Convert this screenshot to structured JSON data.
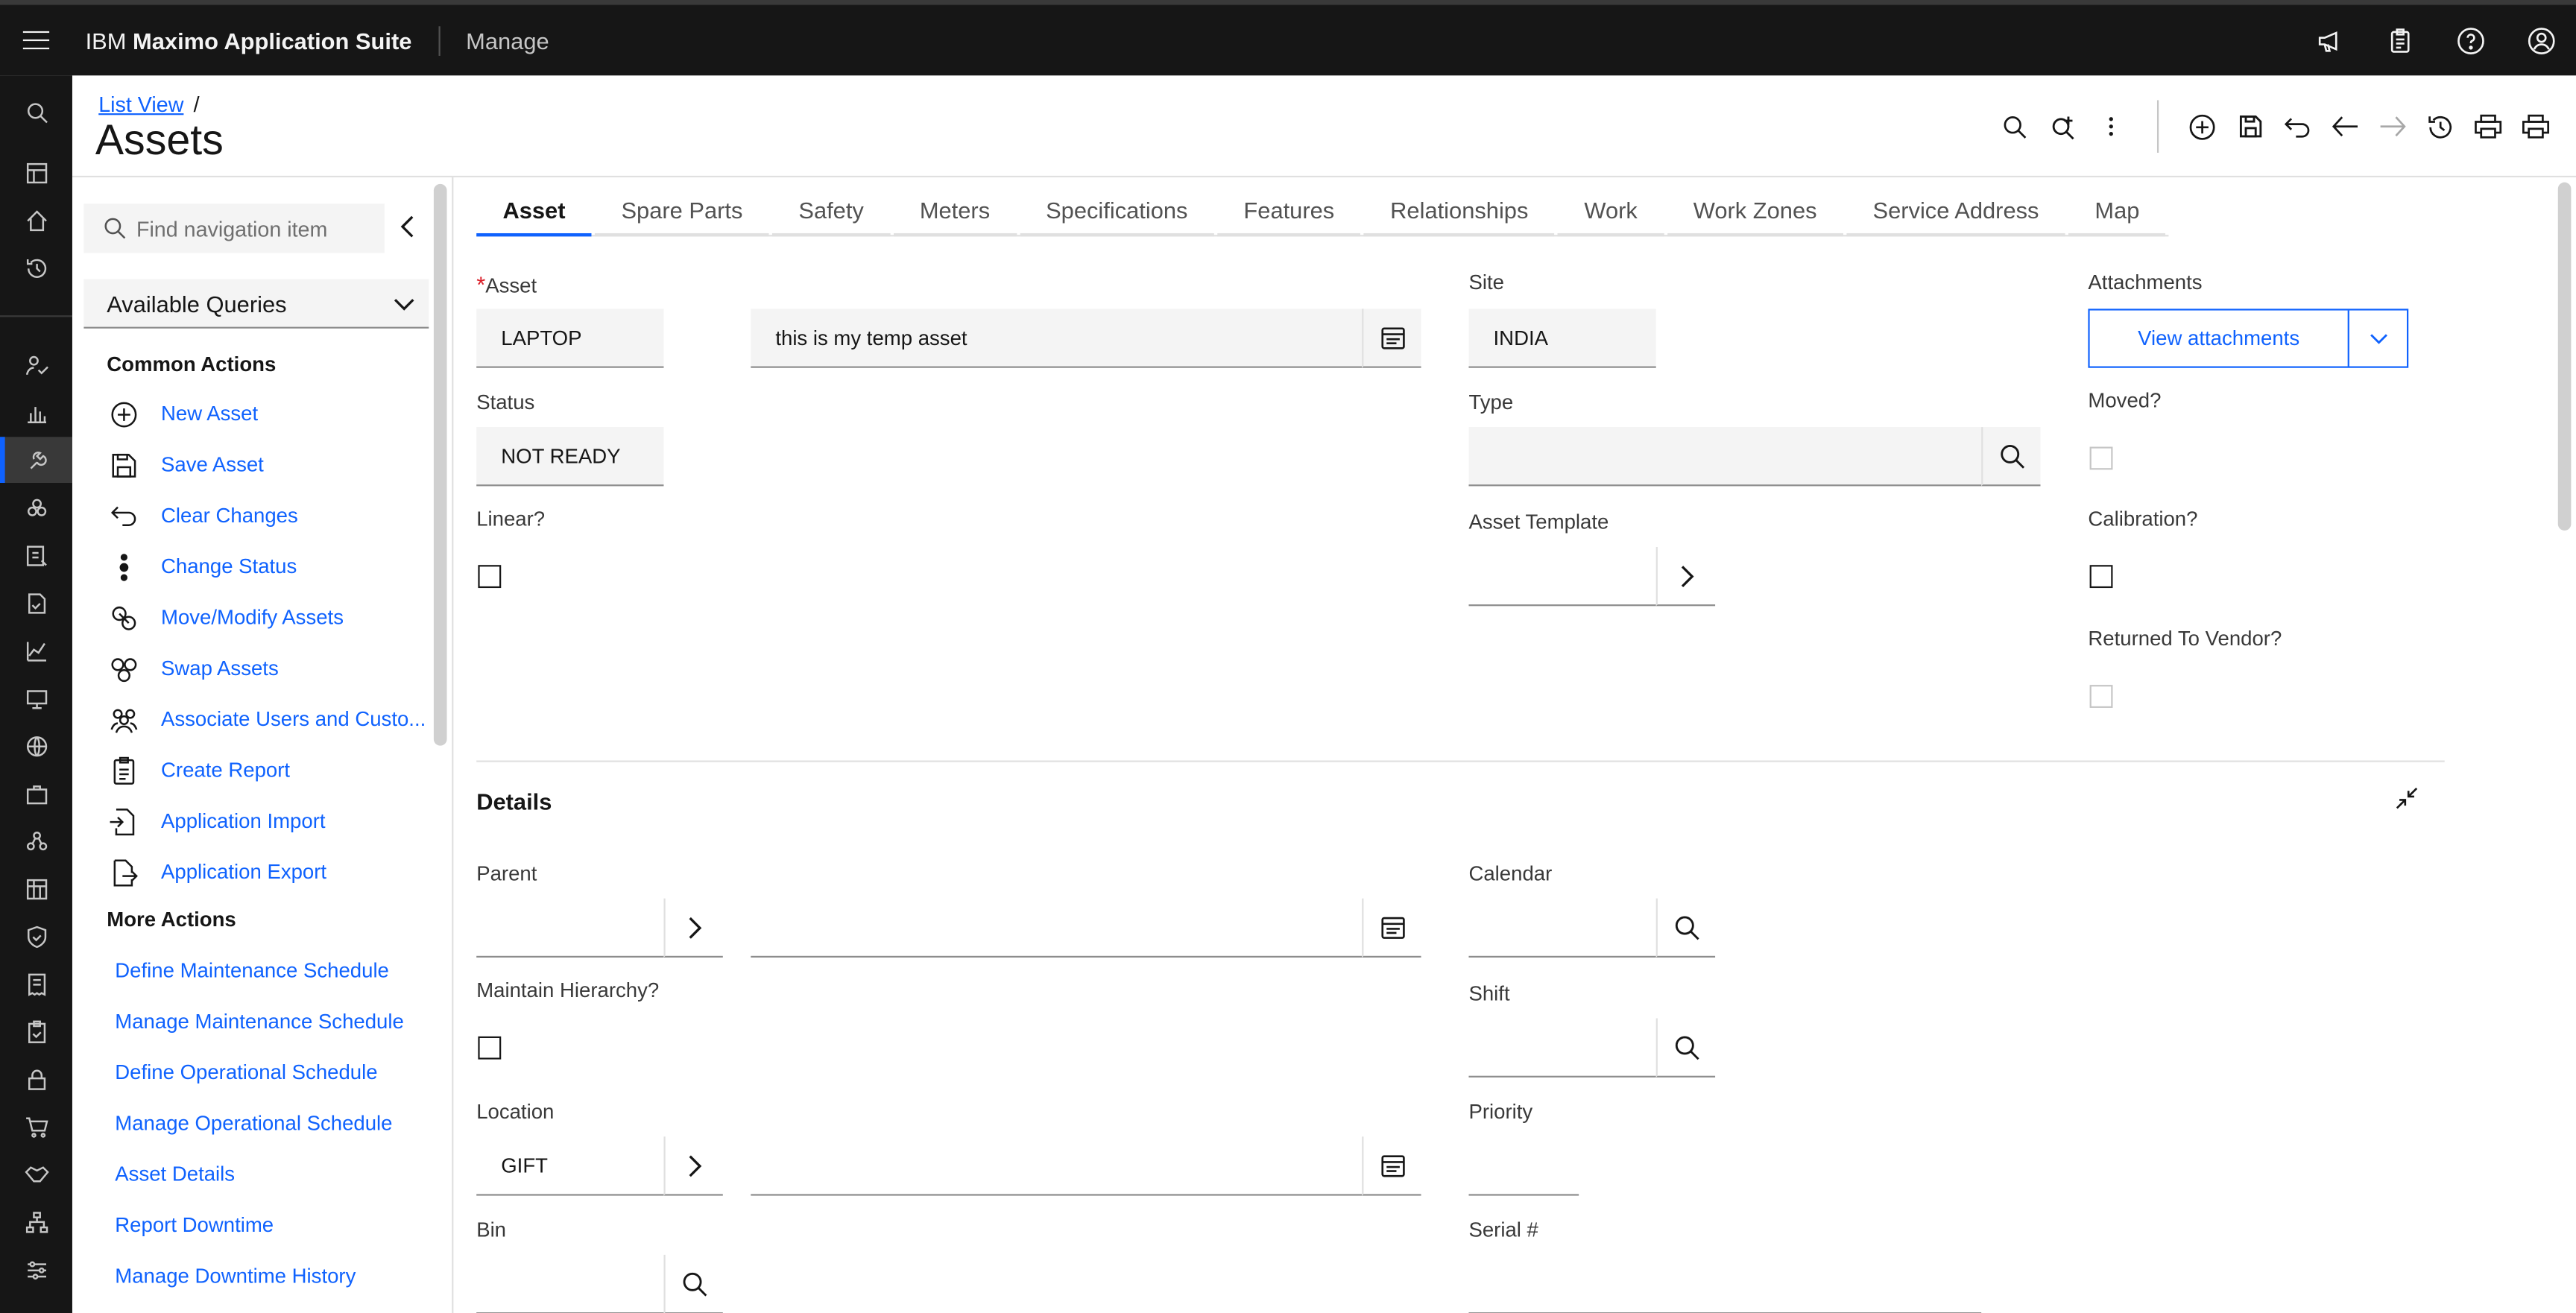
{
  "topbar": {
    "brand_prefix": "IBM",
    "brand_name": "Maximo Application Suite",
    "app_name": "Manage",
    "icons": [
      "megaphone-icon",
      "clipboard-icon",
      "help-icon",
      "user-avatar-icon"
    ]
  },
  "left_rail": {
    "icons": [
      "search-icon",
      "dashboard-icon",
      "home-icon",
      "recent-icon",
      "user-check-icon",
      "chart-bar-icon",
      "assets-icon",
      "cubes-icon",
      "inventory-icon",
      "doc-check-icon",
      "chart-line-icon",
      "screen-icon",
      "network-icon",
      "briefcase-icon",
      "workflow-icon",
      "building-icon",
      "shield-icon",
      "receipt-icon",
      "clipboard-check-icon",
      "lock-icon",
      "cart-icon",
      "handshake-icon",
      "hierarchy-icon",
      "sliders-icon"
    ],
    "active_index": 6
  },
  "header": {
    "breadcrumb": "List View",
    "breadcrumb_sep": "/",
    "title": "Assets",
    "tools": [
      "search-icon",
      "search-add-icon",
      "overflow-menu-icon",
      "add-icon",
      "save-icon",
      "undo-icon",
      "arrow-left-icon",
      "arrow-right-icon",
      "history-icon",
      "print-icon",
      "print-icon"
    ]
  },
  "nav": {
    "search_placeholder": "Find navigation item",
    "queries_label": "Available Queries",
    "common_title": "Common Actions",
    "common_actions": [
      {
        "label": "New Asset",
        "icon": "add-circle-icon"
      },
      {
        "label": "Save Asset",
        "icon": "save-icon"
      },
      {
        "label": "Clear Changes",
        "icon": "undo-icon"
      },
      {
        "label": "Change Status",
        "icon": "status-dots-icon"
      },
      {
        "label": "Move/Modify Assets",
        "icon": "move-asset-icon"
      },
      {
        "label": "Swap Assets",
        "icon": "swap-asset-icon"
      },
      {
        "label": "Associate Users and Custo...",
        "icon": "users-icon"
      },
      {
        "label": "Create Report",
        "icon": "report-icon"
      },
      {
        "label": "Application Import",
        "icon": "import-icon"
      },
      {
        "label": "Application Export",
        "icon": "export-icon"
      }
    ],
    "more_title": "More Actions",
    "more_actions": [
      "Define Maintenance Schedule",
      "Manage Maintenance Schedule",
      "Define Operational Schedule",
      "Manage Operational Schedule",
      "Asset Details",
      "Report Downtime",
      "Manage Downtime History"
    ]
  },
  "tabs": [
    "Asset",
    "Spare Parts",
    "Safety",
    "Meters",
    "Specifications",
    "Features",
    "Relationships",
    "Work",
    "Work Zones",
    "Service Address",
    "Map"
  ],
  "form": {
    "asset_label": "Asset",
    "asset_required": "*",
    "asset_value": "LAPTOP",
    "description_value": "this is my temp asset",
    "site_label": "Site",
    "site_value": "INDIA",
    "attachments_label": "Attachments",
    "view_attachments": "View attachments",
    "status_label": "Status",
    "status_value": "NOT READY",
    "type_label": "Type",
    "type_value": "",
    "moved_label": "Moved?",
    "linear_label": "Linear?",
    "asset_template_label": "Asset Template",
    "calibration_label": "Calibration?",
    "returned_label": "Returned To Vendor?"
  },
  "details": {
    "title": "Details",
    "parent_label": "Parent",
    "parent_value": "",
    "calendar_label": "Calendar",
    "maintain_label": "Maintain Hierarchy?",
    "shift_label": "Shift",
    "location_label": "Location",
    "location_value": "GIFT",
    "priority_label": "Priority",
    "bin_label": "Bin",
    "serial_label": "Serial #"
  },
  "colors": {
    "accent": "#0f62fe",
    "topbar": "#161616",
    "field_bg": "#f4f4f4",
    "required": "#da1e28"
  }
}
